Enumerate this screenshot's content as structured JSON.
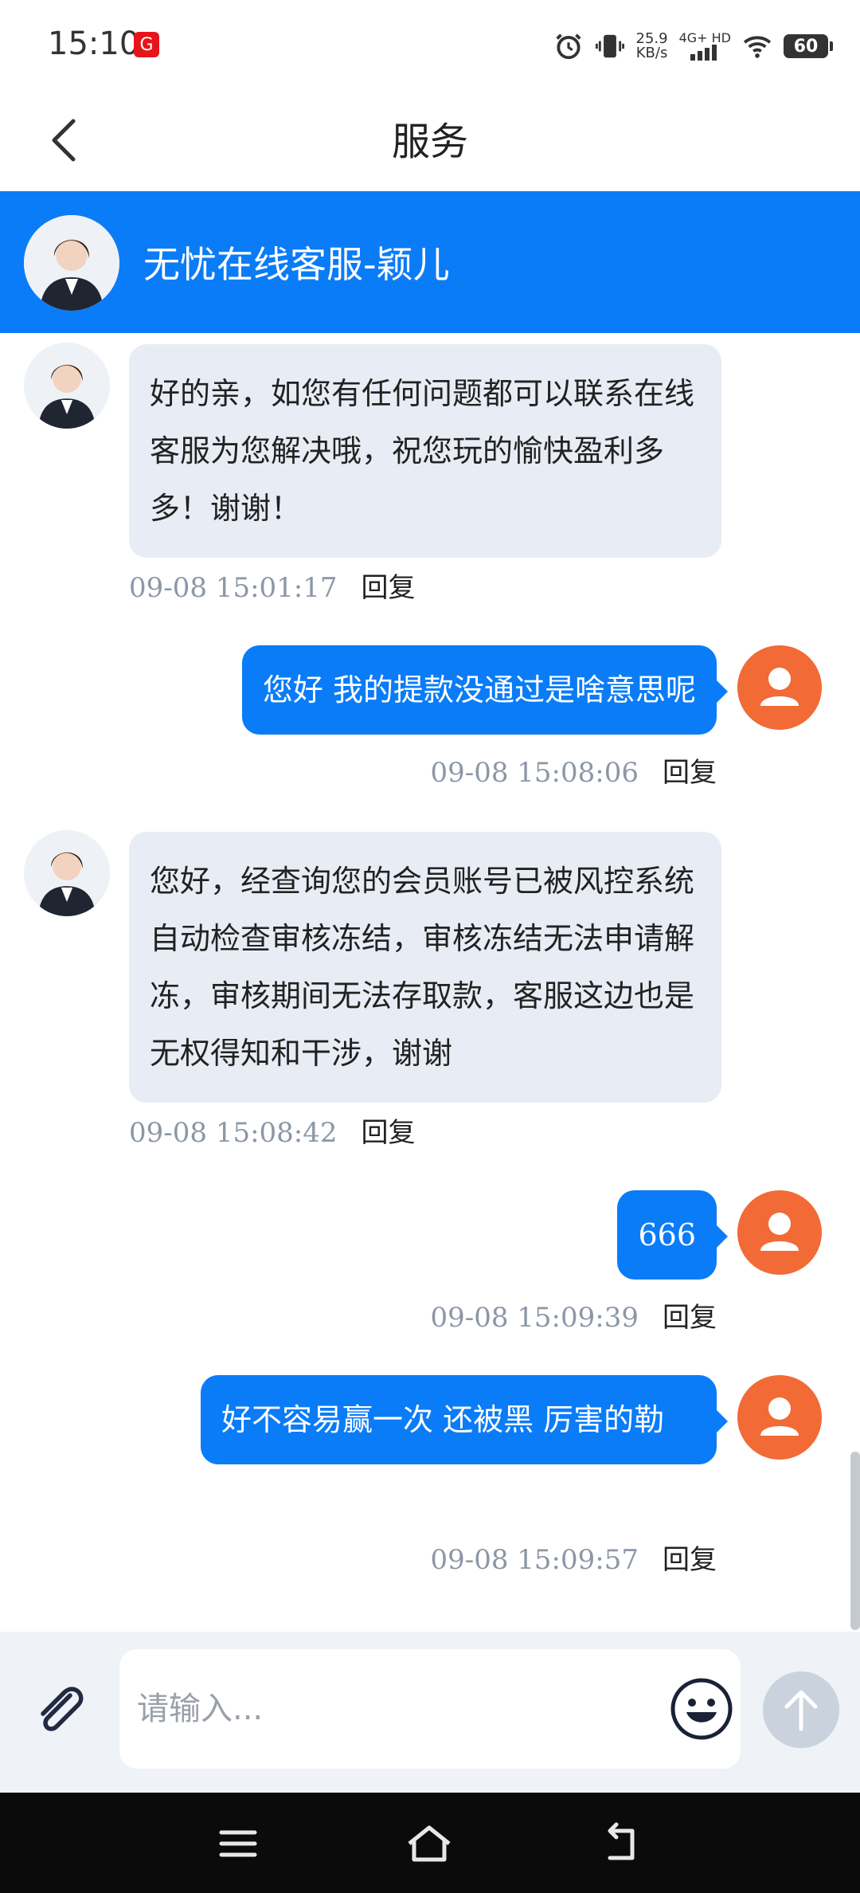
{
  "status_bar": {
    "time": "15:10",
    "app_badge": "G",
    "net_speed_value": "25.9",
    "net_speed_unit": "KB/s",
    "network": "4G+ HD",
    "battery": "60"
  },
  "nav": {
    "title": "服务"
  },
  "agent": {
    "name": "无忧在线客服-颖儿"
  },
  "messages": [
    {
      "side": "left",
      "text": "好的亲，如您有任何问题都可以联系在线客服为您解决哦，祝您玩的愉快盈利多多！谢谢！",
      "time": "09-08 15:01:17",
      "reply_label": "回复"
    },
    {
      "side": "right",
      "text": "您好 我的提款没通过是啥意思呢",
      "time": "09-08 15:08:06",
      "reply_label": "回复"
    },
    {
      "side": "left",
      "text": "您好，经查询您的会员账号已被风控系统自动检查审核冻结，审核冻结无法申请解冻，审核期间无法存取款，客服这边也是无权得知和干涉，谢谢",
      "time": "09-08 15:08:42",
      "reply_label": "回复"
    },
    {
      "side": "right",
      "text": "666",
      "time": "09-08 15:09:39",
      "reply_label": "回复"
    },
    {
      "side": "right",
      "text": "好不容易赢一次 还被黑 厉害的勒",
      "time": "09-08 15:09:57",
      "reply_label": "回复"
    }
  ],
  "input": {
    "placeholder": "请输入..."
  },
  "icons": {
    "back": "chevron-left-icon",
    "attach": "paperclip-icon",
    "emoji": "smile-icon",
    "send": "arrow-up-icon",
    "user": "user-icon",
    "menu": "menu-icon",
    "home": "home-icon",
    "back_nav": "back-nav-icon"
  },
  "colors": {
    "primary": "#0a7cf8",
    "user_avatar": "#f26a35",
    "agent_bubble": "#e8edf5",
    "input_bar": "#eff2f6"
  }
}
